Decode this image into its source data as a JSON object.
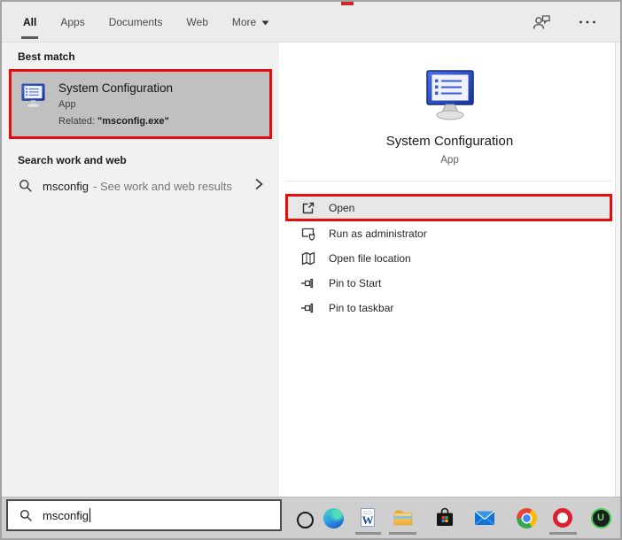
{
  "tabs": {
    "items": [
      "All",
      "Apps",
      "Documents",
      "Web",
      "More"
    ]
  },
  "top_right": {
    "icons": [
      "feedback-icon",
      "ellipsis-icon"
    ]
  },
  "left_panel": {
    "best_match_header": "Best match",
    "best_match": {
      "title": "System Configuration",
      "type": "App",
      "related_prefix": "Related: ",
      "related_value": "\"msconfig.exe\""
    },
    "search_web_header": "Search work and web",
    "suggestion": {
      "query": "msconfig",
      "hint": "- See work and web results"
    }
  },
  "right_panel": {
    "app_title": "System Configuration",
    "app_type": "App",
    "actions": [
      {
        "label": "Open",
        "icon": "open-icon",
        "highlighted": true
      },
      {
        "label": "Run as administrator",
        "icon": "run-as-admin-icon",
        "highlighted": false
      },
      {
        "label": "Open file location",
        "icon": "file-location-icon",
        "highlighted": false
      },
      {
        "label": "Pin to Start",
        "icon": "pin-icon",
        "highlighted": false
      },
      {
        "label": "Pin to taskbar",
        "icon": "pin-icon",
        "highlighted": false
      }
    ]
  },
  "taskbar": {
    "search_value": "msconfig",
    "icons": [
      "cortana-icon",
      "edge-icon",
      "word-icon",
      "file-explorer-icon",
      "store-icon",
      "mail-icon",
      "chrome-icon",
      "opera-icon",
      "u-app-icon"
    ],
    "running_icons": [
      "word-icon",
      "file-explorer-icon",
      "opera-icon"
    ],
    "word_glyph": "W",
    "u_glyph": "U"
  },
  "colors": {
    "annotation_red": "#e60c0c",
    "best_match_bg": "#c0c0c0",
    "open_row_bg": "#e7e7e7",
    "left_panel_bg": "#f1f1f1",
    "tab_bar_bg": "#ebebeb",
    "taskbar_bg": "#cfcfcf",
    "msconfig_blue": "#2a4fd0"
  }
}
